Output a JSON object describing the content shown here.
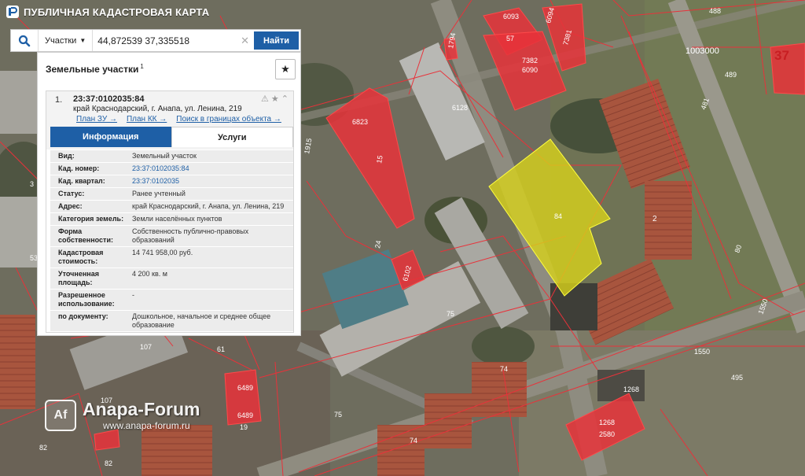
{
  "app": {
    "title": "ПУБЛИЧНАЯ КАДАСТРОВАЯ КАРТА"
  },
  "search": {
    "type_label": "Участки",
    "value": "44,872539 37,335518",
    "button": "Найти"
  },
  "panel": {
    "title": "Земельные участки",
    "title_count": "1",
    "item": {
      "index": "1.",
      "cad_number": "23:37:0102035:84",
      "address": "край Краснодарский, г. Анапа, ул. Ленина, 219",
      "links": [
        "План ЗУ →",
        "План КК →",
        "Поиск в границах объекта →"
      ],
      "tabs": [
        "Информация",
        "Услуги"
      ],
      "info": [
        {
          "key": "Вид:",
          "value": "Земельный участок"
        },
        {
          "key": "Кад. номер:",
          "value": "23:37:0102035:84"
        },
        {
          "key": "Кад. квартал:",
          "value": "23:37:0102035"
        },
        {
          "key": "Статус:",
          "value": "Ранее учтенный"
        },
        {
          "key": "Адрес:",
          "value": "край Краснодарский, г. Анапа, ул. Ленина, 219"
        },
        {
          "key": "Категория земель:",
          "value": "Земли населённых пунктов"
        },
        {
          "key": "Форма собственности:",
          "value": "Собственность публично-правовых образований"
        },
        {
          "key": "Кадастровая стоимость:",
          "value": "14 741 958,00 руб."
        },
        {
          "key": "Уточненная площадь:",
          "value": "4 200 кв. м"
        },
        {
          "key": "Разрешенное использование:",
          "value": "-"
        },
        {
          "key": "по документу:",
          "value": "Дошкольное, начальное и среднее общее образование"
        }
      ]
    }
  },
  "map_labels": {
    "l6093": "6093",
    "l57": "57",
    "l6094": "6094",
    "l7381": "7381",
    "l7382": "7382",
    "l6090": "6090",
    "l488": "488",
    "l1003000": "1003000",
    "l37": "37",
    "l489": "489",
    "l1794": "1794",
    "l6128": "6128",
    "l6823": "6823",
    "l15": "15",
    "l84": "84",
    "l2": "2",
    "l481": "481",
    "l80": "80",
    "l1550a": "1550",
    "l1550b": "1550",
    "l6102": "6102",
    "l75a": "75",
    "l75b": "75",
    "l74a": "74",
    "l74b": "74",
    "l1268a": "1268",
    "l1268b": "1268",
    "l2580": "2580",
    "l495": "495",
    "l6489a": "6489",
    "l6489b": "6489",
    "l19": "19",
    "l107a": "107",
    "l107b": "107",
    "l61": "61",
    "l82a": "82",
    "l82b": "82",
    "l53": "53",
    "l3": "3",
    "l24": "24",
    "l1915": "1915"
  },
  "watermark": {
    "logo": "Af",
    "name": "Anapa-Forum",
    "url": "www.anapa-forum.ru"
  },
  "colors": {
    "accent": "#1e5fa6",
    "parcel_red": "#e8323a",
    "selected_yellow": "#d8d21a"
  }
}
